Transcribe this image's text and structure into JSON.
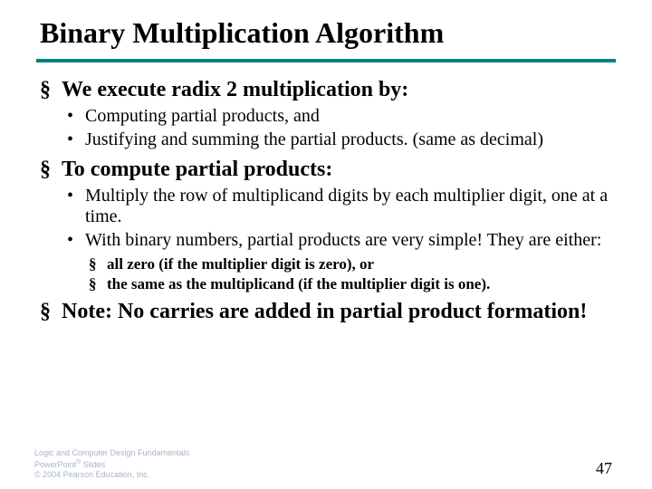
{
  "title": "Binary Multiplication Algorithm",
  "bullets": {
    "b1": "We execute radix 2 multiplication by:",
    "b1_1": "Computing partial products, and",
    "b1_2": "Justifying and summing the partial products. (same as decimal)",
    "b2": "To compute partial products:",
    "b2_1": "Multiply the row of multiplicand digits by each multiplier digit, one at a time.",
    "b2_2": "With binary numbers, partial products are very simple!  They are either:",
    "b2_2_1": "all zero (if the multiplier digit is zero), or",
    "b2_2_2": "the same as the multiplicand (if the multiplier digit is one).",
    "b3": "Note: No carries are added in partial product formation!"
  },
  "footer": {
    "line1": "Logic and Computer Design Fundamentals",
    "line2_a": "PowerPoint",
    "line2_sup": "®",
    "line2_b": " Slides",
    "line3": "© 2004 Pearson Education, Inc."
  },
  "page": "47"
}
